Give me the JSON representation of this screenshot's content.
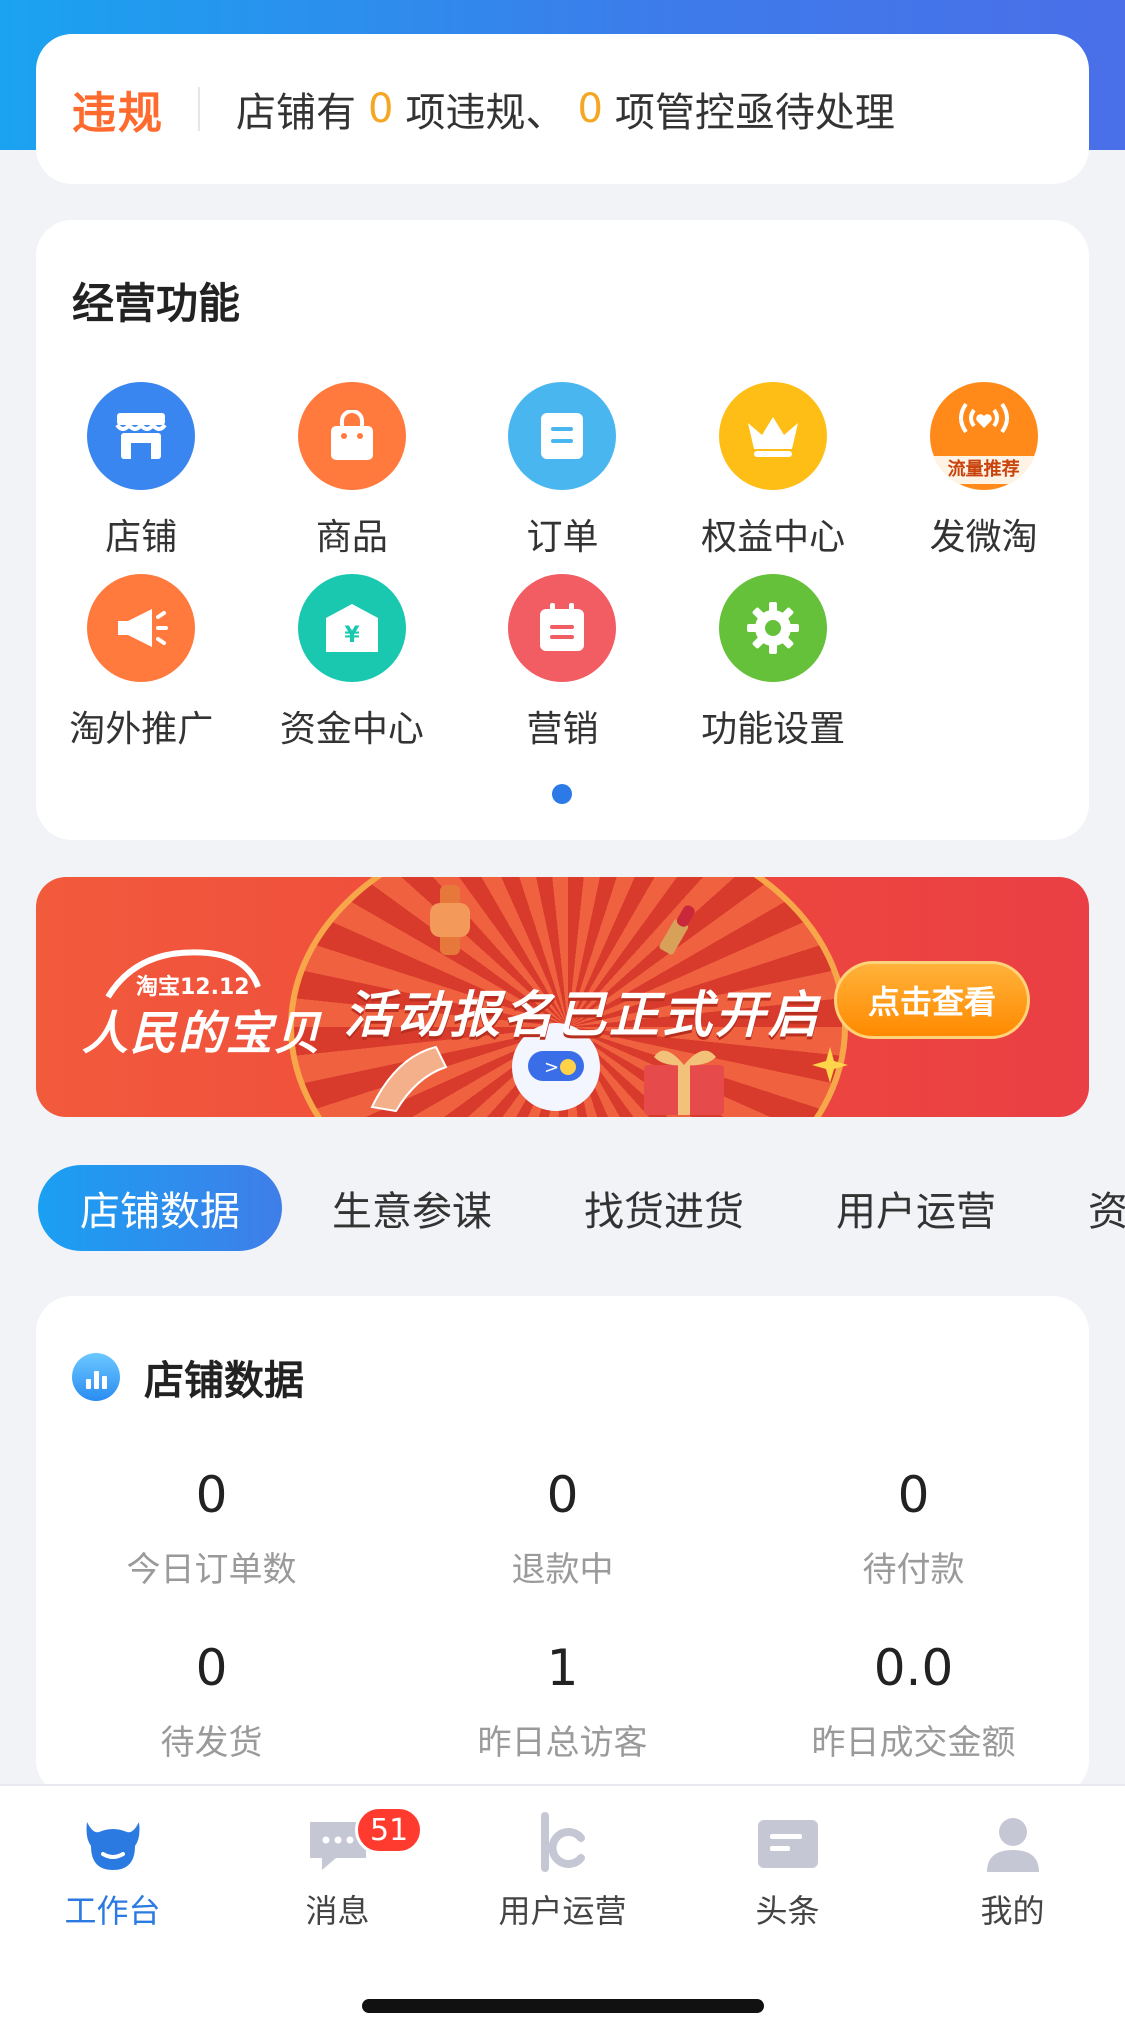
{
  "violation": {
    "tag": "违规",
    "prefix": "店铺有",
    "count_violation": "0",
    "middle": "项违规、",
    "count_control": "0",
    "suffix": "项管控亟待处理"
  },
  "functions": {
    "title": "经营功能",
    "items": [
      {
        "label": "店铺",
        "icon": "store-icon",
        "color": "#3a86f0"
      },
      {
        "label": "商品",
        "icon": "shopping-bag-icon",
        "color": "#ff7a3c"
      },
      {
        "label": "订单",
        "icon": "order-doc-icon",
        "color": "#4ab6f0"
      },
      {
        "label": "权益中心",
        "icon": "crown-icon",
        "color": "#ffbe16"
      },
      {
        "label": "发微淘",
        "icon": "broadcast-heart-icon",
        "color": "#ff8a1a",
        "sublabel": "流量推荐"
      },
      {
        "label": "淘外推广",
        "icon": "megaphone-icon",
        "color": "#ff7a3c"
      },
      {
        "label": "资金中心",
        "icon": "fund-icon",
        "color": "#1ac8b0"
      },
      {
        "label": "营销",
        "icon": "calendar-icon",
        "color": "#f25c63"
      },
      {
        "label": "功能设置",
        "icon": "gear-icon",
        "color": "#65c03a"
      }
    ]
  },
  "banner": {
    "logo_top": "淘宝12.12",
    "logo": "人民的宝贝",
    "headline": "活动报名已正式开启",
    "cta": "点击查看"
  },
  "tabs": [
    "店铺数据",
    "生意参谋",
    "找货进货",
    "用户运营",
    "资金"
  ],
  "store_data": {
    "title": "店铺数据",
    "metrics": [
      {
        "value": "0",
        "label": "今日订单数"
      },
      {
        "value": "0",
        "label": "退款中"
      },
      {
        "value": "0",
        "label": "待付款"
      },
      {
        "value": "0",
        "label": "待发货"
      },
      {
        "value": "1",
        "label": "昨日总访客"
      },
      {
        "value": "0.0",
        "label": "昨日成交金额"
      }
    ]
  },
  "tabbar": {
    "items": [
      {
        "label": "工作台",
        "icon": "workbench-icon"
      },
      {
        "label": "消息",
        "icon": "message-icon",
        "badge": "51"
      },
      {
        "label": "用户运营",
        "icon": "user-ops-icon"
      },
      {
        "label": "头条",
        "icon": "headline-icon"
      },
      {
        "label": "我的",
        "icon": "profile-icon"
      }
    ]
  }
}
